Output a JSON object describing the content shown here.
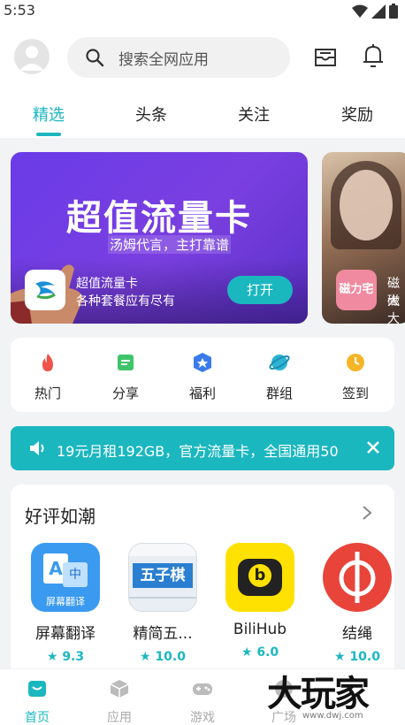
{
  "status_bar": {
    "time": "5:53"
  },
  "header": {
    "search_placeholder": "搜索全网应用",
    "tabs": [
      {
        "label": "精选"
      },
      {
        "label": "头条"
      },
      {
        "label": "关注"
      },
      {
        "label": "奖励"
      }
    ]
  },
  "banner": {
    "title": "超值流量卡",
    "subtitle": "汤姆代言，主打靠谱",
    "app_name": "超值流量卡",
    "app_desc": "各种套餐应有尽有",
    "open_label": "打开",
    "next_app_icon_text": "磁力宅",
    "next_app_line1": "磁大",
    "next_app_line2": "磁大"
  },
  "quick_links": [
    {
      "label": "热门",
      "icon": "flame-icon",
      "color": "#f0534a"
    },
    {
      "label": "分享",
      "icon": "share-icon",
      "color": "#3fc46b"
    },
    {
      "label": "福利",
      "icon": "gift-badge-icon",
      "color": "#3a7bea"
    },
    {
      "label": "群组",
      "icon": "planet-icon",
      "color": "#2bb4d4"
    },
    {
      "label": "签到",
      "icon": "clock-icon",
      "color": "#f5b526"
    }
  ],
  "notice": {
    "text": "19元月租192GB，官方流量卡，全国通用50"
  },
  "recommend": {
    "title": "好评如潮",
    "apps": [
      {
        "name": "屏幕翻译",
        "rating": "9.3",
        "icon_text": "屏幕翻译"
      },
      {
        "name": "精简五...",
        "rating": "10.0",
        "icon_text": "五子棋"
      },
      {
        "name": "BiliHub",
        "rating": "6.0",
        "icon_text": "b"
      },
      {
        "name": "结绳",
        "rating": "10.0",
        "icon_text": ""
      }
    ]
  },
  "bottom_nav": [
    {
      "label": "首页"
    },
    {
      "label": "应用"
    },
    {
      "label": "游戏"
    },
    {
      "label": "广场"
    }
  ],
  "watermark": {
    "text": "大玩家",
    "site": "www.dwj.com"
  },
  "colors": {
    "accent": "#1bb7bf",
    "banner": "#6a3be8"
  }
}
